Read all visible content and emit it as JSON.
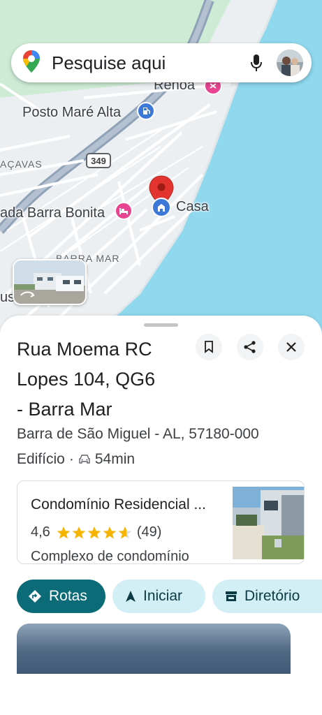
{
  "search": {
    "placeholder": "Pesquise aqui",
    "icons": [
      "maps-pin-logo",
      "mic-icon",
      "avatar"
    ]
  },
  "map": {
    "labels": {
      "renoa": "Renoa",
      "posto": "Posto Maré Alta",
      "macavas": "AÇAVAS",
      "route": "349",
      "barra_bonita": "ada Barra Bonita",
      "barra_mar_area": "BARRA MAR",
      "casa": "Casa",
      "us": "us"
    },
    "colors": {
      "water": "#8fd8ee",
      "land": "#eceff1",
      "green": "#cdebd5",
      "highway": "#8fa2b8",
      "pin_red": "#e3342f",
      "poi_pink": "#e8448f",
      "poi_blue": "#3c78d8"
    }
  },
  "sheet": {
    "title_lines": [
      "Rua Moema RC",
      "Lopes 104, QG6",
      "- Barra Mar"
    ],
    "address": "Barra de São Miguel - AL, 57180-000",
    "category": "Edifício",
    "separator": "·",
    "drive_time": "54min",
    "buttons": {
      "save_icon": "bookmark-icon",
      "share_icon": "share-icon",
      "close_icon": "close-icon"
    },
    "card": {
      "name": "Condomínio Residencial ...",
      "rating": "4,6",
      "stars": 4.6,
      "reviews": "(49)",
      "type": "Complexo de condomínio"
    },
    "actions": [
      {
        "label": "Rotas",
        "icon": "directions-icon"
      },
      {
        "label": "Iniciar",
        "icon": "navigation-arrow-icon"
      },
      {
        "label": "Diretório",
        "icon": "storefront-icon"
      }
    ],
    "colors": {
      "primary": "#0b6b77",
      "tonal": "#d3eff6",
      "star": "#f6b400"
    }
  }
}
